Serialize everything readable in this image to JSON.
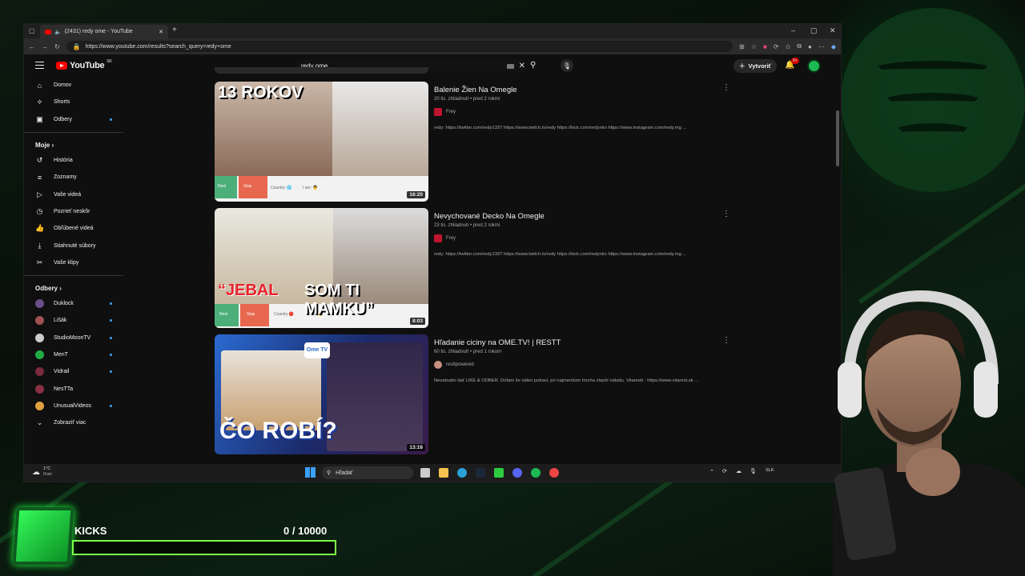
{
  "browser": {
    "tab_title": "(2431) redy ome - YouTube",
    "url": "https://www.youtube.com/results?search_query=redy+ome"
  },
  "youtube": {
    "logo_text": "YouTube",
    "country_code": "SK",
    "search_value": "redy ome",
    "create_label": "Vytvoriť",
    "notification_count": "9+"
  },
  "sidebar": {
    "main": [
      {
        "label": "Domov",
        "icon": "home-icon"
      },
      {
        "label": "Shorts",
        "icon": "shorts-icon"
      },
      {
        "label": "Odbery",
        "icon": "subscriptions-icon"
      }
    ],
    "you_title": "Moje",
    "you": [
      {
        "label": "História",
        "icon": "history-icon"
      },
      {
        "label": "Zoznamy",
        "icon": "playlists-icon"
      },
      {
        "label": "Vaše videá",
        "icon": "your-videos-icon"
      },
      {
        "label": "Pozrieť neskôr",
        "icon": "watch-later-icon"
      },
      {
        "label": "Obľúbené videá",
        "icon": "liked-icon"
      },
      {
        "label": "Stiahnuté súbory",
        "icon": "download-icon"
      },
      {
        "label": "Vaše klipy",
        "icon": "clips-icon"
      }
    ],
    "subs_title": "Odbery",
    "subs": [
      {
        "label": "Duklock",
        "color": "#6a4e8a"
      },
      {
        "label": "Lišák",
        "color": "#a05050"
      },
      {
        "label": "StudioMoonTV",
        "color": "#cccccc"
      },
      {
        "label": "MenT",
        "color": "#22aa44"
      },
      {
        "label": "Vidrail",
        "color": "#7a2a3a"
      },
      {
        "label": "NesTTa",
        "color": "#8a3040"
      },
      {
        "label": "UnusualVideos",
        "color": "#e0a040"
      }
    ],
    "show_more": "Zobraziť viac"
  },
  "videos": [
    {
      "title": "Balenie Žien Na Omegle",
      "meta": "20 tis. zhliadnutí • pred 2 rokmi",
      "channel": "Frey",
      "description": "redy: https://twitter.com/redy1337 https://www.twitch.tv/redy https://kick.com/redynko https://www.instagram.com/redy.mg ...",
      "duration": "16:20",
      "thumb_text": "13 ROKOV",
      "thumb_labels": [
        "Next",
        "Stop",
        "Country: 🌐",
        "I am: 👨"
      ]
    },
    {
      "title": "Nevychované Decko Na Omegle",
      "meta": "23 tis. zhliadnutí • pred 2 rokmi",
      "channel": "Frey",
      "description": "redy: https://twitter.com/redy1337 https://www.twitch.tv/redy https://kick.com/redynko https://www.instagram.com/redy.mg ...",
      "duration": "8:03",
      "thumb_text_1": "“JEBAL",
      "thumb_text_2": "SOM TI MAMKU”",
      "thumb_labels": [
        "Next",
        "Stop",
        "Country 🔴",
        "I am 👨"
      ]
    },
    {
      "title": "Hľadanie ciciny na OME.TV! | RESTT",
      "meta": "60 tis. zhliadnutí • pred 1 rokom",
      "channel": "resttpowered",
      "description": "Nezabudni dať LIKE & ODBER. Dúfam že video pobavi, pri najmenšom trocha zlepší náladu. Vitarestt - https://www.vitarest.sk ...",
      "duration": "13:16",
      "thumb_text": "ČO ROBÍ?",
      "badge": "Ome TV"
    }
  ],
  "taskbar": {
    "weather_temp": "1°C",
    "weather_desc": "Rain",
    "search_label": "Hľadať",
    "lang": "SLK"
  },
  "kicks": {
    "label": "KICKS",
    "current": "0",
    "goal": "/ 10000",
    "progress": 0
  },
  "colors": {
    "accent_green": "#7cff4a",
    "youtube_red": "#ff0000",
    "yt_bg": "#0f0f0f"
  }
}
